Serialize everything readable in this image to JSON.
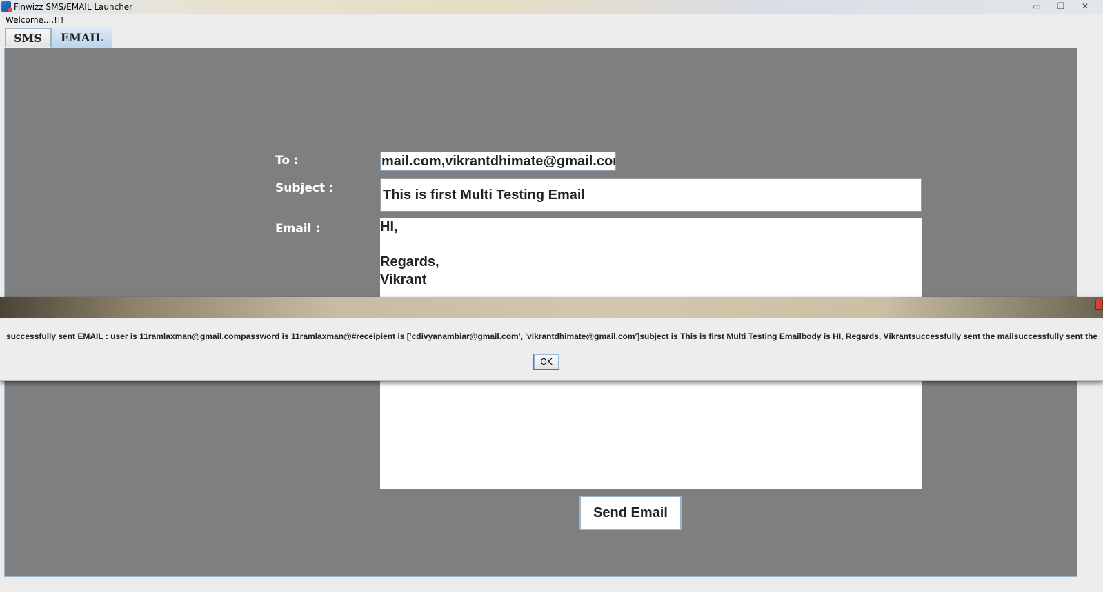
{
  "window": {
    "title": "Finwizz SMS/EMAIL Launcher",
    "controls": {
      "minimize": "▭",
      "restore": "❐",
      "close": "✕"
    }
  },
  "welcome": "Welcome....!!!",
  "tabs": [
    {
      "label": "SMS",
      "selected": false
    },
    {
      "label": "EMAIL",
      "selected": true
    }
  ],
  "form": {
    "to_label": "To :",
    "to_value": "mail.com,vikrantdhimate@gmail.com",
    "subject_label": "Subject :",
    "subject_value": "This is first Multi Testing Email",
    "email_label": "Email :",
    "email_lines": [
      "HI,",
      "",
      "Regards,",
      "Vikrant"
    ],
    "send_label": "Send Email"
  },
  "dialog": {
    "message": "successfully sent EMAIL : user is  11ramlaxman@gmail.compassword is  11ramlaxman@#receipient is  ['cdivyanambiar@gmail.com', 'vikrantdhimate@gmail.com']subject is  This is first Multi Testing Emailbody is  HI, Regards, Vikrantsuccessfully sent the mailsuccessfully sent the",
    "ok_label": "OK"
  },
  "colors": {
    "panel_background": "#7f7f7f",
    "label_text": "#ffffff",
    "selected_tab": "#bcd4ec"
  }
}
